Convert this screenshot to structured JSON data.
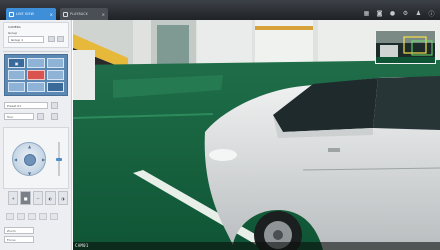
{
  "tabs": [
    {
      "label": "LIVE VIEW",
      "active": true
    },
    {
      "label": "PLAYBACK",
      "active": false
    }
  ],
  "toolbar_icons": [
    "layout-icon",
    "snapshot-icon",
    "record-icon",
    "settings-icon",
    "user-icon",
    "info-icon"
  ],
  "panel": {
    "group_title": "CAMERA",
    "group_subtitle": "Group",
    "group_select": "Group 1",
    "field_preset": "Preset 01",
    "field_tour": "Tour",
    "field_a": "Zoom",
    "field_b": "Focus"
  },
  "video": {
    "camera_label": "CAM01"
  },
  "colors": {
    "accent": "#3f8fd8",
    "floor": "#1f7a4f",
    "alert": "#d9534f"
  }
}
